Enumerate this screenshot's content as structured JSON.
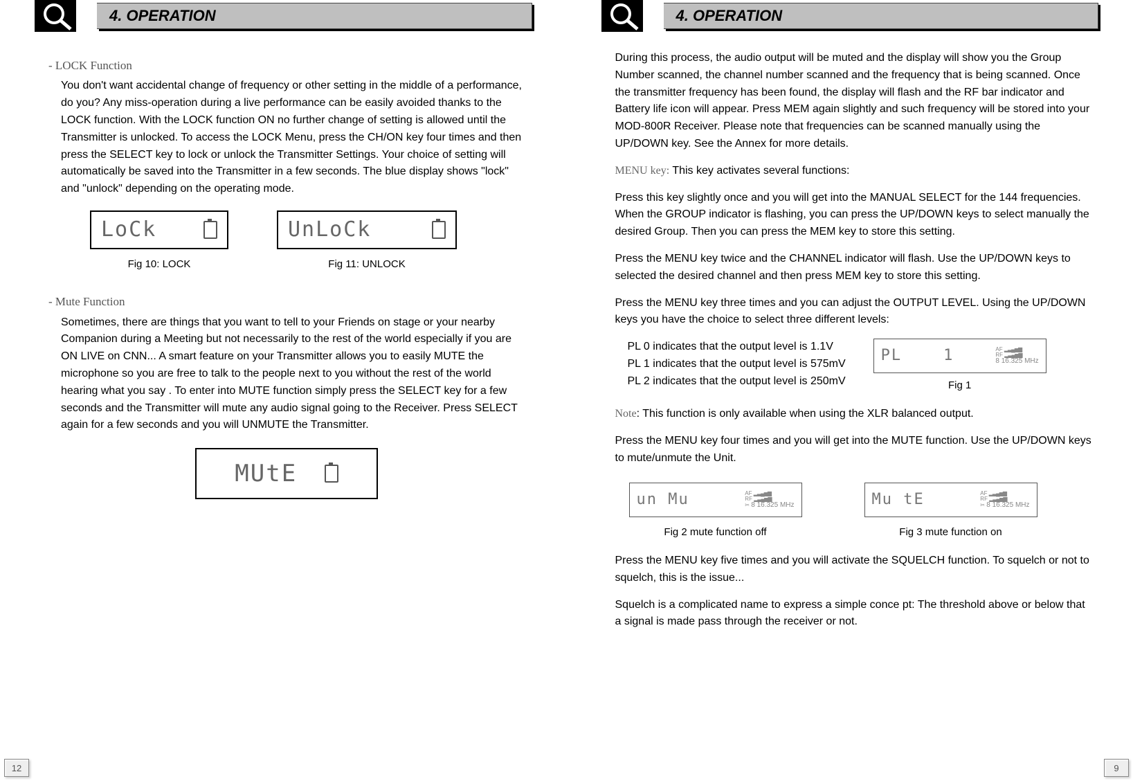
{
  "left": {
    "header": "4. OPERATION",
    "lock_heading": "- LOCK  Function",
    "lock_body": "You don't want accidental change of frequency or other setting in the middle of a performance, do you? Any miss-operation during a live performance can be easily avoided thanks to the LOCK function. With the LOCK function ON no further change of setting is allowed until the Transmitter is unlocked. To access the LOCK Menu, press the CH/ON key four times and then press the SELECT key to lock or unlock the Transmitter Settings. Your choice of setting will automatically be saved into the Transmitter in a few seconds. The blue display shows \"lock\" and \"unlock\" depending on the operating mode.",
    "fig10_lcd": "LoCk",
    "fig10_cap": "Fig 10: LOCK",
    "fig11_lcd": "UnLoCk",
    "fig11_cap": "Fig 11: UNLOCK",
    "mute_heading": "- Mute Function",
    "mute_body": "Sometimes, there are things that you want to tell to your Friends on stage or your nearby Companion during a Meeting but not necessarily to the rest of the world especially if you are ON LIVE on CNN... A smart feature on your Transmitter allows you to easily MUTE the microphone so you are free to talk to the people next to you without the rest of the world hearing what you say . To enter into MUTE function simply press the SELECT key for a few seconds and the Transmitter will mute any audio signal going to the Receiver. Press SELECT again for a few seconds and you will UNMUTE the Transmitter.",
    "mute_lcd": "MUtE",
    "page_num": "12"
  },
  "right": {
    "header": "4. OPERATION",
    "p1": "During this process, the audio output will be muted and the display will show you the Group Number scanned, the channel number scanned and the frequency that is being scanned. Once the transmitter frequency has been found, the display will flash and the RF bar indicator and Battery life icon will appear. Press MEM again slightly and such frequency will be stored into your MOD-800R Receiver. Please note that frequencies can be scanned manually using the UP/DOWN key. See the Annex for more details.",
    "menu_label": "MENU key:",
    "menu_intro": " This key activates several functions:",
    "p2": "Press this key slightly once and you will get into the MANUAL SELECT for the 144 frequencies. When the GROUP indicator is flashing, you can press the UP/DOWN keys to select manually the desired Group. Then you can press the MEM key to store this setting.",
    "p3": "Press the MENU key twice and the CHANNEL indicator will flash. Use the UP/DOWN keys to selected the desired channel and then press MEM key to store this setting.",
    "p4": "Press the MENU key three times and you can adjust the OUTPUT LEVEL. Using the UP/DOWN keys you have the choice to select three different levels:",
    "pl0": "PL 0 indicates that the output level is 1.1V",
    "pl1": "PL 1 indicates that the output level is 575mV",
    "pl2": "PL 2 indicates that the output level is 250mV",
    "fig1_lcd_left": "PL",
    "fig1_lcd_right": "1",
    "fig1_freq": "8 16.325 MHz",
    "fig1_cap": "Fig 1",
    "note_label": "Note",
    "note_body": ": This function is only available when using the XLR balanced output.",
    "p5": "Press the MENU key four times and you will get into the MUTE function. Use the UP/DOWN keys to mute/unmute the Unit.",
    "fig2_lcd": "un Mu",
    "fig2_freq": "8 16.325 MHz",
    "fig2_cap": "Fig 2  mute function off",
    "fig3_lcd": "Mu tE",
    "fig3_freq": "8 16.325 MHz",
    "fig3_cap": "Fig 3 mute function on",
    "p6": "Press the MENU key five times and you will activate the SQUELCH function. To squelch or not to squelch, this is the issue...",
    "p7": "Squelch is a complicated name to express a simple conce pt: The threshold above or below that a signal is made pass through the receiver or not.",
    "page_num": "9"
  },
  "meters": {
    "af": "AF",
    "rf": "RF",
    "bars": "▂▃▄▅▆"
  }
}
